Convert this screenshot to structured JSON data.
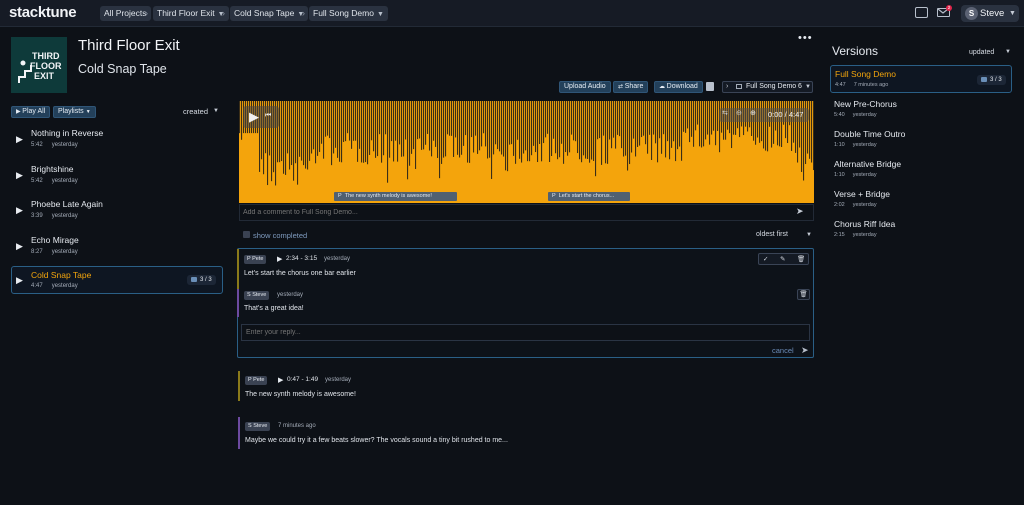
{
  "app": {
    "logo": "stacktune"
  },
  "breadcrumb": [
    {
      "label": "All Projects",
      "has_chevron": false
    },
    {
      "label": "Third Floor Exit",
      "has_chevron": true
    },
    {
      "label": "Cold Snap Tape",
      "has_chevron": true
    },
    {
      "label": "Full Song Demo",
      "has_chevron": true
    }
  ],
  "header_icons": {
    "notifications_count": "2"
  },
  "user": {
    "initial": "S",
    "name": "Steve"
  },
  "album": {
    "art_text": "THIRD FLOOR EXIT",
    "band": "Third Floor Exit",
    "title": "Cold Snap Tape"
  },
  "more_icon": "•••",
  "actions": {
    "upload": "Upload Audio",
    "share": "Share",
    "download": "Download",
    "version_selector": "Full Song Demo",
    "version_count": "6"
  },
  "tracklist": {
    "play_all": "Play All",
    "playlists": "Playlists",
    "sort": "created",
    "tracks": [
      {
        "name": "Nothing in Reverse",
        "duration": "5:42",
        "age": "yesterday",
        "active": false
      },
      {
        "name": "Brightshine",
        "duration": "5:42",
        "age": "yesterday",
        "active": false
      },
      {
        "name": "Phoebe Late Again",
        "duration": "3:39",
        "age": "yesterday",
        "active": false
      },
      {
        "name": "Echo Mirage",
        "duration": "8:27",
        "age": "yesterday",
        "active": false
      },
      {
        "name": "Cold Snap Tape",
        "duration": "4:47",
        "age": "yesterday",
        "active": true,
        "badge": "3 / 3"
      }
    ]
  },
  "player": {
    "time": "0:00 / 4:47",
    "markers": [
      {
        "author_initial": "P",
        "text": "The new synth melody is awesome!",
        "pos": 0.165
      },
      {
        "author_initial": "P",
        "text": "Let's start the chorus...",
        "pos": 0.49
      }
    ],
    "progress": 0,
    "comment_placeholder": "Add a comment to Full Song Demo..."
  },
  "comments": {
    "show_completed": "show completed",
    "sort": "oldest first",
    "threads": [
      {
        "author": "Pete",
        "initial": "P",
        "range": "2:34 - 3:15",
        "age": "yesterday",
        "text": "Let's start the chorus one bar earlier",
        "replies": [
          {
            "author": "Steve",
            "initial": "S",
            "age": "yesterday",
            "text": "That's a great idea!"
          }
        ],
        "reply_placeholder": "Enter your reply...",
        "cancel": "cancel"
      },
      {
        "author": "Pete",
        "initial": "P",
        "range": "0:47 - 1:49",
        "age": "yesterday",
        "text": "The new synth melody is awesome!"
      },
      {
        "author": "Steve",
        "initial": "S",
        "range": "",
        "age": "7 minutes ago",
        "text": "Maybe we could try it a few beats slower? The vocals sound a tiny bit rushed to me..."
      }
    ]
  },
  "versions": {
    "title": "Versions",
    "sort": "updated",
    "items": [
      {
        "name": "Full Song Demo",
        "duration": "4:47",
        "age": "7 minutes ago",
        "active": true,
        "badge": "3 / 3"
      },
      {
        "name": "New Pre-Chorus",
        "duration": "5:40",
        "age": "yesterday",
        "active": false
      },
      {
        "name": "Double Time Outro",
        "duration": "1:10",
        "age": "yesterday",
        "active": false
      },
      {
        "name": "Alternative Bridge",
        "duration": "1:10",
        "age": "yesterday",
        "active": false
      },
      {
        "name": "Verse + Bridge",
        "duration": "2:02",
        "age": "yesterday",
        "active": false
      },
      {
        "name": "Chorus Riff Idea",
        "duration": "2:15",
        "age": "yesterday",
        "active": false
      }
    ]
  },
  "colors": {
    "accent": "#f4a40c",
    "highlight_border": "#2a5f86",
    "background": "#0d1117"
  }
}
